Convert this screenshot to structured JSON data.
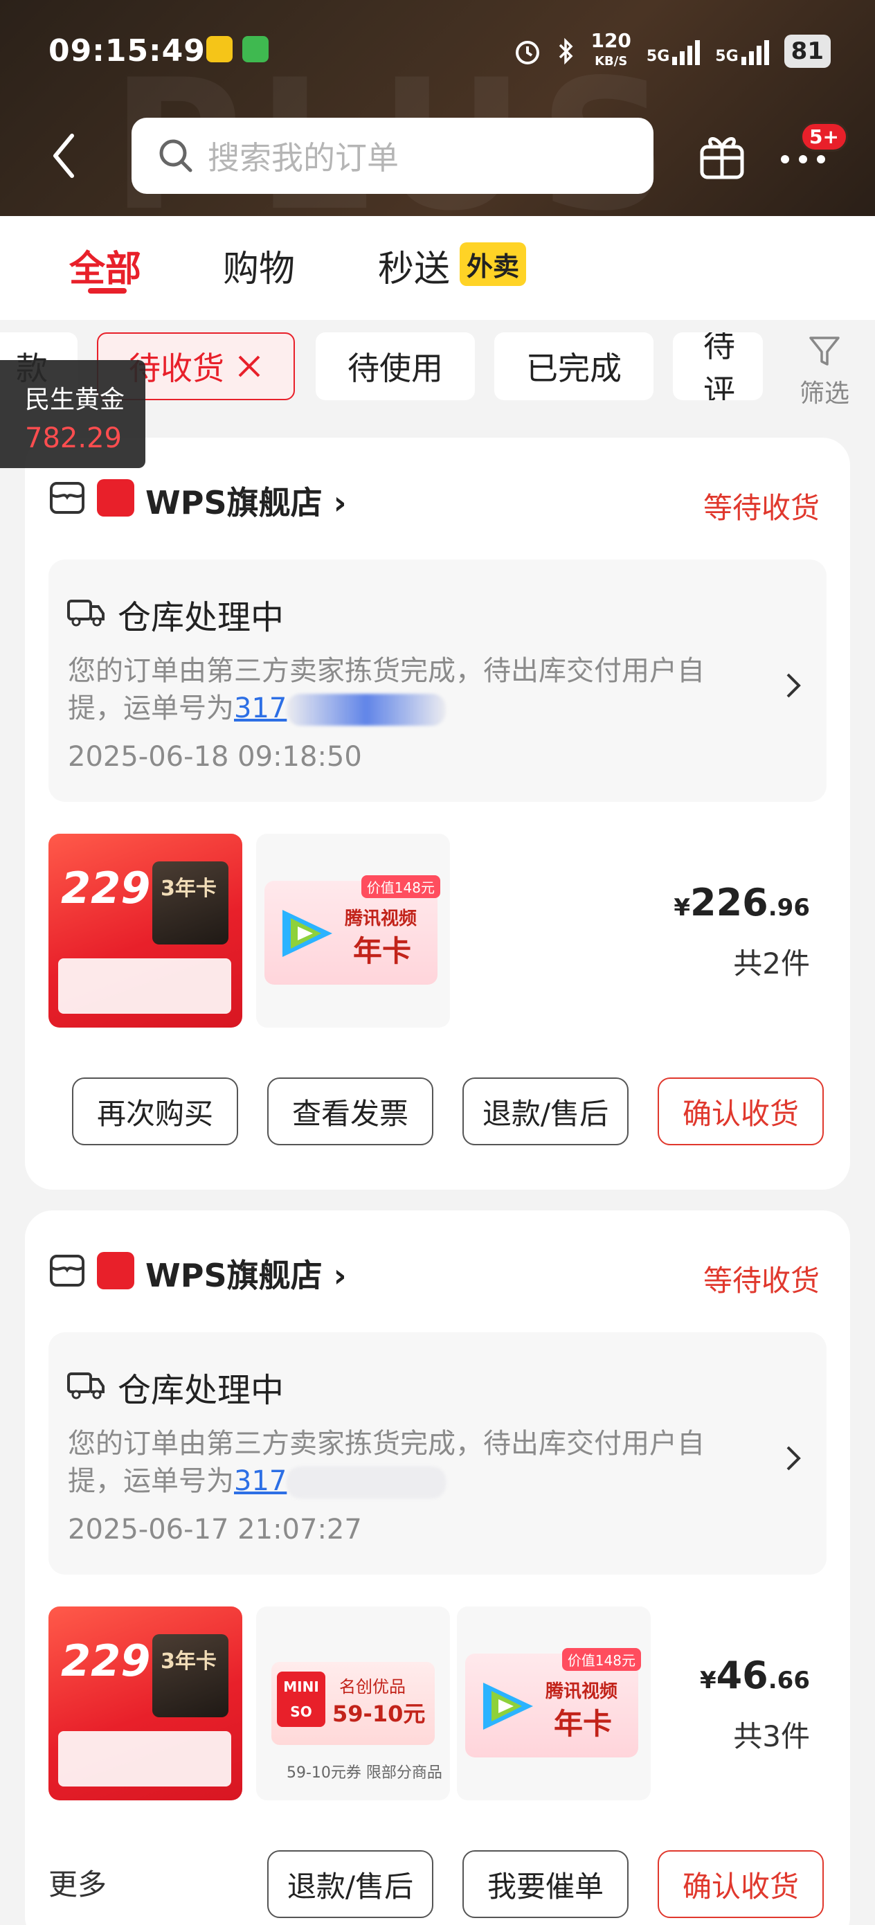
{
  "status_bar": {
    "time": "09:15:49",
    "net_speed": "120",
    "net_unit": "KB/S",
    "sig1": "5G",
    "sig2": "5G",
    "battery": "81"
  },
  "header": {
    "search_placeholder": "搜索我的订单",
    "more_badge": "5+"
  },
  "tabs": [
    {
      "label": "全部",
      "active": true
    },
    {
      "label": "购物"
    },
    {
      "label": "秒送",
      "badge": "外卖"
    }
  ],
  "filters": {
    "partial_left": "款",
    "chips": [
      "待收货",
      "待使用",
      "已完成",
      "待评"
    ],
    "filter_label": "筛选"
  },
  "overlay": {
    "name": "民生黄金",
    "value": "782.29"
  },
  "orders": [
    {
      "store": "WPS旗舰店",
      "status": "等待收货",
      "ship_title": "仓库处理中",
      "ship_desc_line1": "您的订单由第三方卖家拣货完成，待出库交付用户自",
      "ship_desc_line2": "提，运单号为",
      "tracking_prefix": "317",
      "time": "2025-06-18 09:18:50",
      "price_yen": "¥",
      "price_int": "226",
      "price_dec": ".96",
      "qty": "共2件",
      "thumbs": [
        {
          "big": "229",
          "card": "3年卡"
        },
        {
          "tag": "价值148元",
          "t1": "腾讯视频",
          "t2": "年卡"
        }
      ],
      "buttons": [
        "再次购买",
        "查看发票",
        "退款/售后",
        "确认收货"
      ]
    },
    {
      "store": "WPS旗舰店",
      "status": "等待收货",
      "ship_title": "仓库处理中",
      "ship_desc_line1": "您的订单由第三方卖家拣货完成，待出库交付用户自",
      "ship_desc_line2": "提，运单号为",
      "tracking_prefix": "317",
      "time": "2025-06-17 21:07:27",
      "price_yen": "¥",
      "price_int": "46",
      "price_dec": ".66",
      "qty": "共3件",
      "thumbs": [
        {
          "big": "229",
          "card": "3年卡"
        },
        {
          "logo": "MINI SO",
          "mt": "名创优品",
          "mv": "59-10元",
          "cap": "59-10元券 限部分商品"
        },
        {
          "tag": "价值148元",
          "t1": "腾讯视频",
          "t2": "年卡"
        }
      ],
      "more": "更多",
      "buttons": [
        "退款/售后",
        "我要催单",
        "确认收货"
      ]
    }
  ]
}
